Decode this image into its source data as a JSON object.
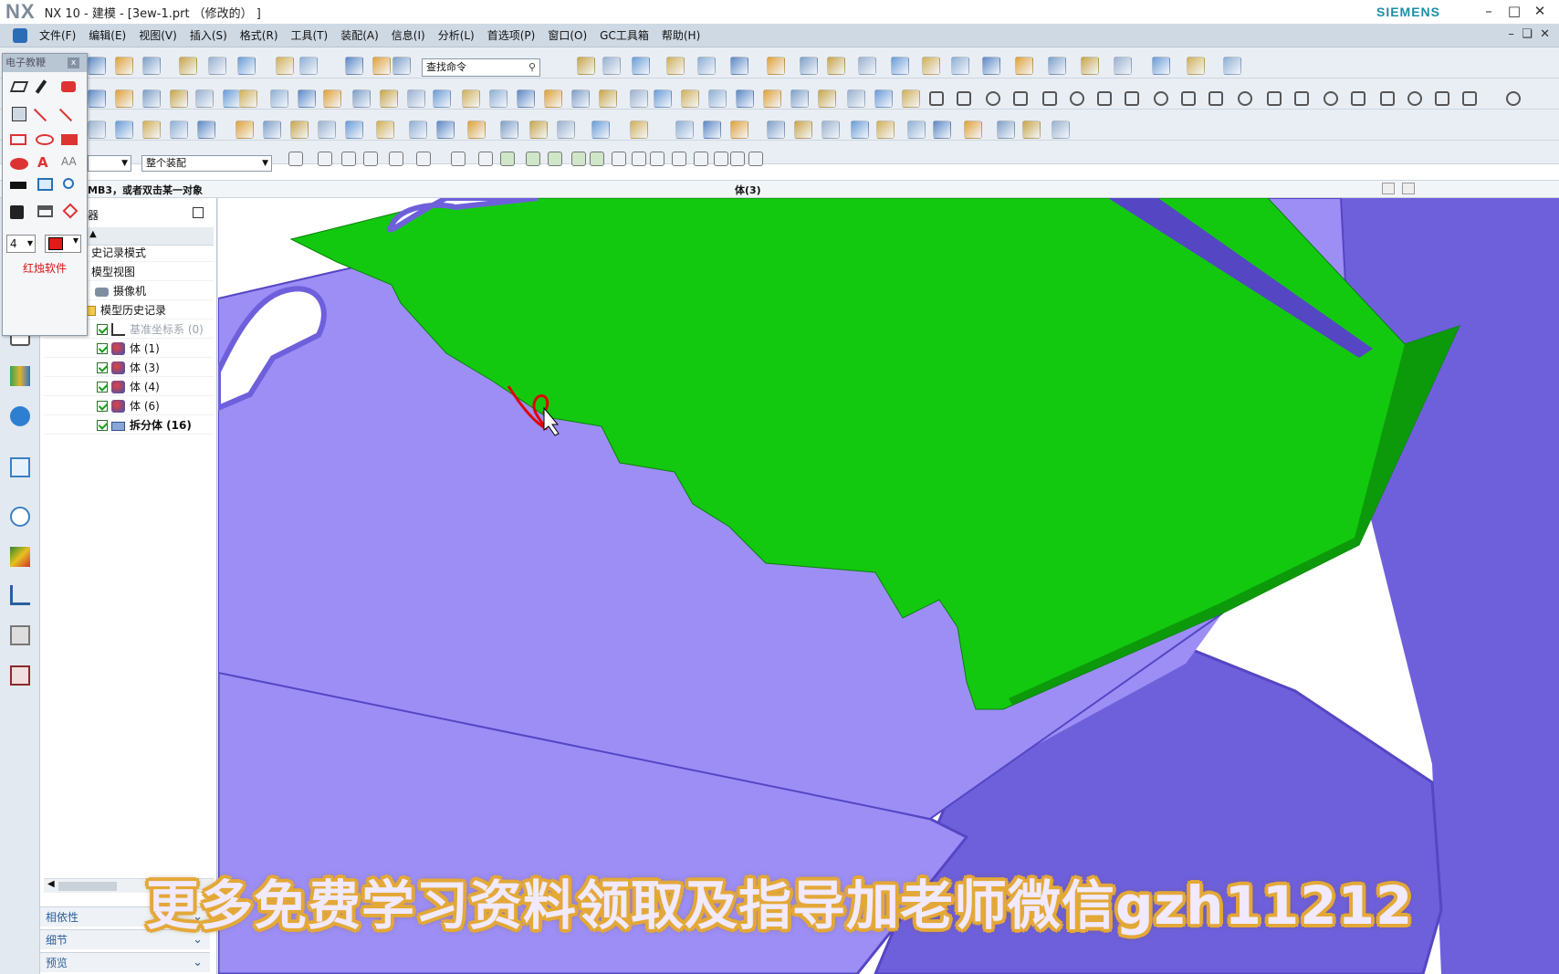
{
  "window": {
    "logo": "NX",
    "title": "NX 10 - 建模 - [3ew-1.prt （修改的） ]",
    "brand": "SIEMENS"
  },
  "menu": [
    "文件(F)",
    "编辑(E)",
    "视图(V)",
    "插入(S)",
    "格式(R)",
    "工具(T)",
    "装配(A)",
    "信息(I)",
    "分析(L)",
    "首选项(P)",
    "窗口(O)",
    "GC工具箱",
    "帮助(H)"
  ],
  "toolbar": {
    "search_value": "查找命令",
    "assembly_filter": "整个装配"
  },
  "status": {
    "prompt": "MB3，或者双击某一对象",
    "selection": "体(3)"
  },
  "overlay_panel": {
    "title": "电子教鞭",
    "width_value": "4",
    "brand": "红烛软件"
  },
  "navigator": {
    "title": "器",
    "rows": [
      {
        "label": "史记录模式"
      },
      {
        "label": "模型视图"
      },
      {
        "label": "摄像机"
      },
      {
        "label": "模型历史记录"
      },
      {
        "label": "基准坐标系 (0)"
      },
      {
        "label": "体 (1)"
      },
      {
        "label": "体 (3)"
      },
      {
        "label": "体 (4)"
      },
      {
        "label": "体 (6)"
      },
      {
        "label": "拆分体 (16)"
      }
    ],
    "sections": [
      {
        "label": "相依性"
      },
      {
        "label": "细节"
      },
      {
        "label": "预览"
      }
    ]
  },
  "viewport": {
    "colors": {
      "body_main": "#9c8ef5",
      "body_side": "#6e60db",
      "body_dark": "#5546c4",
      "selected": "#13c90f",
      "selected_edge": "#0c9a0a"
    }
  },
  "watermark": "更多免费学习资料领取及指导加老师微信gzh11212"
}
